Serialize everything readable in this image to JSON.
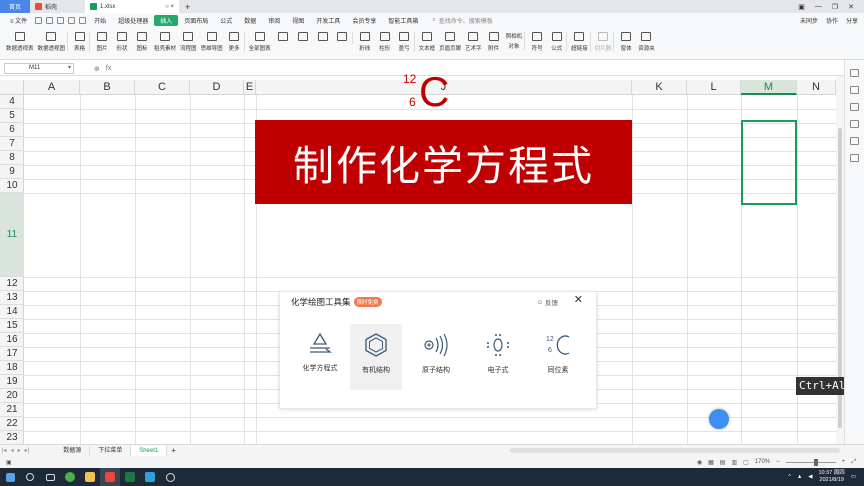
{
  "titlebar": {
    "tabs": [
      {
        "label": "首页"
      },
      {
        "label": "稻壳"
      },
      {
        "label": "1.xlsx"
      }
    ],
    "add_tab": "+"
  },
  "menubar": {
    "file": "≡ 文件",
    "items": [
      "开始",
      "超级处理器",
      "插入",
      "页面布局",
      "公式",
      "数据",
      "审阅",
      "视图",
      "开发工具",
      "会员专享",
      "智能工具箱"
    ],
    "active": "插入",
    "search_placeholder": "查找命令、搜索模板",
    "right": [
      "未同步",
      "协作",
      "分享"
    ]
  },
  "ribbon": {
    "items": [
      "数据透视表",
      "数据透视图",
      "表格",
      "图片",
      "形状",
      "图标",
      "稻壳素材",
      "流程图",
      "思维导图",
      "更多",
      "全部图表",
      "",
      "",
      "",
      "",
      "折线",
      "柱形",
      "盈亏",
      "文本框",
      "页眉页脚",
      "艺术字",
      "附件",
      "对象",
      "符号",
      "公式",
      "超链接",
      "切片器",
      "窗体",
      "资源夹"
    ],
    "extra": "照相机"
  },
  "formula_bar": {
    "name_box": "M11",
    "fx": "fx"
  },
  "columns": [
    "A",
    "B",
    "C",
    "D",
    "E",
    "J",
    "K",
    "L",
    "M",
    "N"
  ],
  "rows": [
    "4",
    "5",
    "6",
    "7",
    "8",
    "9",
    "10",
    "11",
    "12",
    "13",
    "14",
    "15",
    "16",
    "17",
    "18",
    "19",
    "20",
    "21",
    "22",
    "23"
  ],
  "selected_column": "M",
  "selected_row": "11",
  "banner": {
    "text": "制作化学方程式"
  },
  "isotope": {
    "mass": "12",
    "number": "6",
    "symbol": "C"
  },
  "chem_panel": {
    "title": "化学绘图工具集",
    "badge": "限时免费",
    "feedback": "反馈",
    "tools": [
      {
        "label": "化学方程式",
        "icon": "equation-icon"
      },
      {
        "label": "有机结构",
        "icon": "hexagon-icon"
      },
      {
        "label": "原子结构",
        "icon": "atom-icon"
      },
      {
        "label": "电子式",
        "icon": "electron-icon"
      },
      {
        "label": "同位素",
        "icon": "isotope-icon"
      }
    ]
  },
  "keyboard_hint": "Ctrl+Alt+",
  "sheet_tabs": {
    "tabs": [
      "数据源",
      "下拉菜单",
      "Sheet1"
    ],
    "active": "Sheet1",
    "add": "+"
  },
  "status": {
    "zoom": "170%"
  },
  "taskbar": {
    "time": "10:37 周四",
    "date": "2021/8/19"
  },
  "colors": {
    "accent_green": "#1a9b5c",
    "banner_red": "#c00000",
    "badge_orange": "#f5784b"
  }
}
